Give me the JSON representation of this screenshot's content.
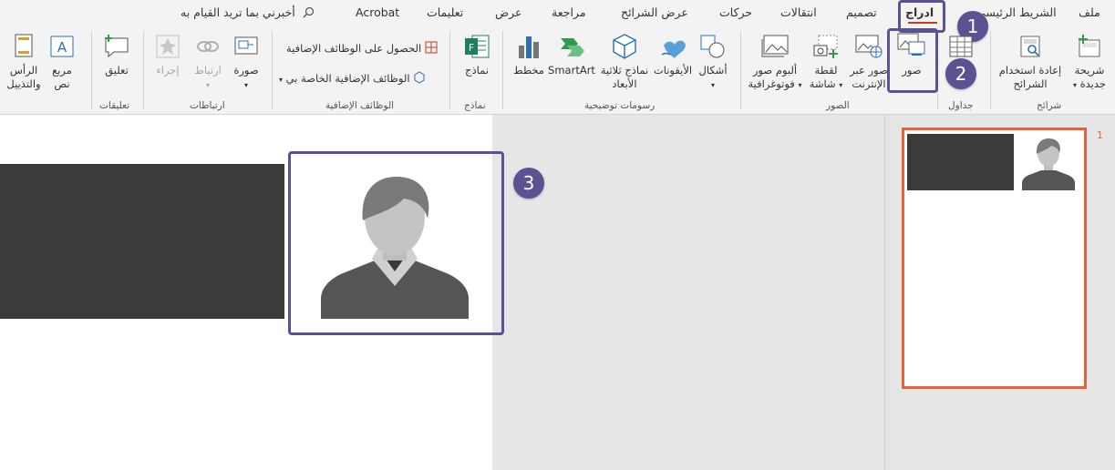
{
  "tabs": [
    {
      "id": "file",
      "label": "ملف"
    },
    {
      "id": "home",
      "label": "الشريط الرئيسي"
    },
    {
      "id": "insert",
      "label": "ادراج"
    },
    {
      "id": "design",
      "label": "تصميم"
    },
    {
      "id": "transitions",
      "label": "انتقالات"
    },
    {
      "id": "animations",
      "label": "حركات"
    },
    {
      "id": "slideshow",
      "label": "عرض الشرائح"
    },
    {
      "id": "review",
      "label": "مراجعة"
    },
    {
      "id": "view",
      "label": "عرض"
    },
    {
      "id": "help",
      "label": "تعليمات"
    },
    {
      "id": "acrobat",
      "label": "Acrobat"
    }
  ],
  "tellme": "أخبرني بما تريد القيام به",
  "groups": {
    "slides": "شرائح",
    "tables": "جداول",
    "images": "الصور",
    "illustrations": "رسومات توضيحية",
    "forms": "نماذج",
    "addins": "الوظائف الإضافية",
    "links": "ارتباطات",
    "comments": "تعليقات"
  },
  "buttons": {
    "new_slide_1": "شريحة",
    "new_slide_2": "جديدة",
    "reuse_1": "إعادة استخدام",
    "reuse_2": "الشرائح",
    "pictures": "صور",
    "online_pictures_1": "صور عبر",
    "online_pictures_2": "الإنترنت",
    "screenshot_1": "لقطة",
    "screenshot_2": "شاشة",
    "photo_album_1": "ألبوم صور",
    "photo_album_2": "فوتوغرافية",
    "shapes": "أشكال",
    "icons": "الأيقونات",
    "models_3d_1": "نماذج ثلاثية",
    "models_3d_2": "الأبعاد",
    "smartart": "SmartArt",
    "chart": "مخطط",
    "forms": "نماذج",
    "get_addins": "الحصول على الوظائف الإضافية",
    "my_addins": "الوظائف الإضافية الخاصة بي",
    "picture_link": "صورة",
    "link": "ارتباط",
    "action": "إجراء",
    "comment": "تعليق",
    "textbox_1": "مربع",
    "textbox_2": "نص",
    "header_1": "الرأس",
    "header_2": "والتذييل"
  },
  "badges": [
    "1",
    "2",
    "3"
  ],
  "slide_number": "1",
  "colors": {
    "accent": "#5b5294",
    "thumb_border": "#e8603c",
    "dark_band": "#3b3b3b",
    "insert_underline": "#c43e1c"
  }
}
